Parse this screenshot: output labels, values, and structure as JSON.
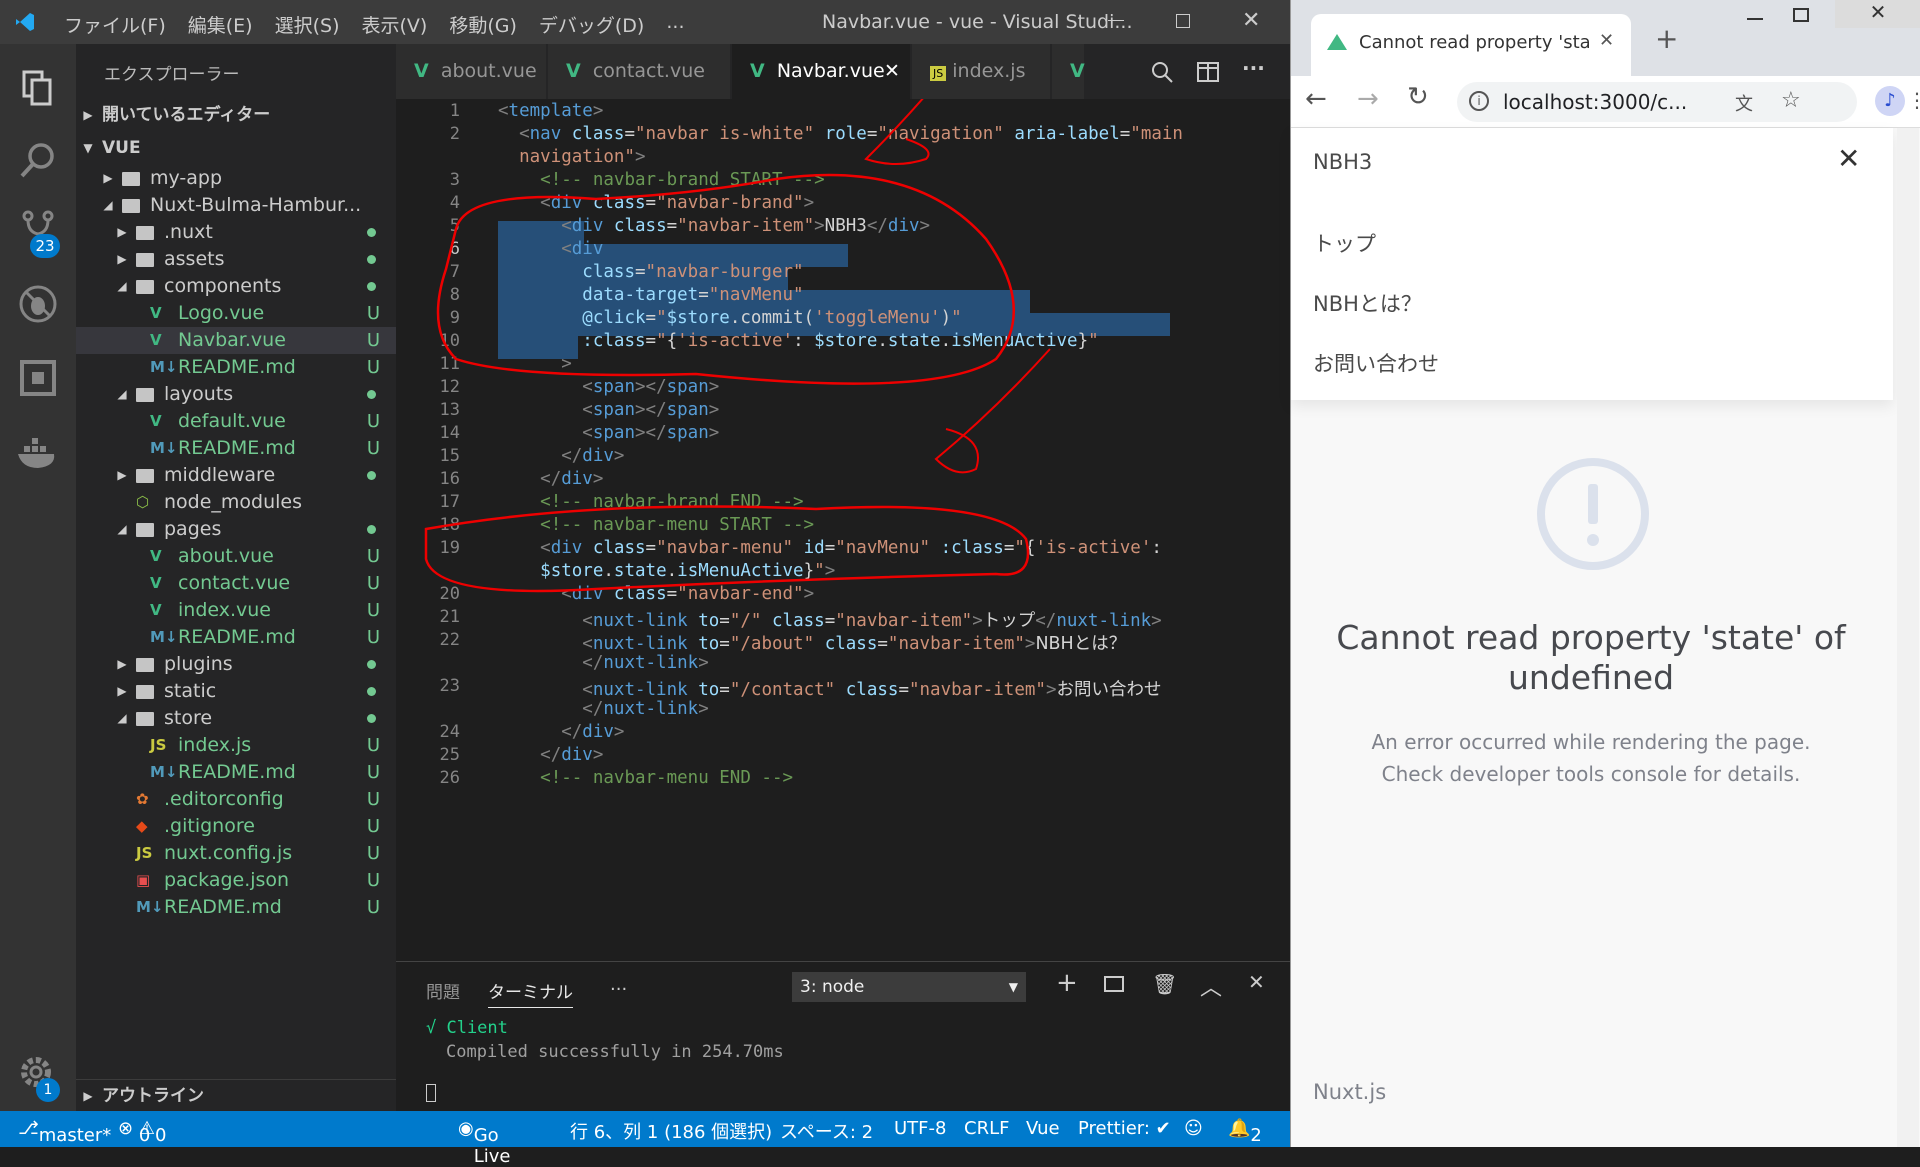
{
  "vscode": {
    "menu": [
      "ファイル(F)",
      "編集(E)",
      "選択(S)",
      "表示(V)",
      "移動(G)",
      "デバッグ(D)",
      "..."
    ],
    "window_title": "Navbar.vue - vue - Visual Studi...",
    "scm_badge": "23",
    "settings_badge": "1",
    "explorer_title": "エクスプローラー",
    "open_editors": "開いているエディター",
    "root": "VUE",
    "outline": "アウトライン",
    "tree": [
      {
        "label": "my-app",
        "status": ""
      },
      {
        "label": "Nuxt-Bulma-Hambur...",
        "status": ""
      },
      {
        "label": ".nuxt",
        "status": ""
      },
      {
        "label": "assets",
        "status": ""
      },
      {
        "label": "components",
        "status": ""
      },
      {
        "label": "Logo.vue",
        "status": "U"
      },
      {
        "label": "Navbar.vue",
        "status": "U"
      },
      {
        "label": "README.md",
        "status": "U"
      },
      {
        "label": "layouts",
        "status": ""
      },
      {
        "label": "default.vue",
        "status": "U"
      },
      {
        "label": "README.md",
        "status": "U"
      },
      {
        "label": "middleware",
        "status": ""
      },
      {
        "label": "node_modules",
        "status": ""
      },
      {
        "label": "pages",
        "status": ""
      },
      {
        "label": "about.vue",
        "status": "U"
      },
      {
        "label": "contact.vue",
        "status": "U"
      },
      {
        "label": "index.vue",
        "status": "U"
      },
      {
        "label": "README.md",
        "status": "U"
      },
      {
        "label": "plugins",
        "status": ""
      },
      {
        "label": "static",
        "status": ""
      },
      {
        "label": "store",
        "status": ""
      },
      {
        "label": "index.js",
        "status": "U"
      },
      {
        "label": "README.md",
        "status": "U"
      },
      {
        "label": ".editorconfig",
        "status": "U"
      },
      {
        "label": ".gitignore",
        "status": "U"
      },
      {
        "label": "nuxt.config.js",
        "status": "U"
      },
      {
        "label": "package.json",
        "status": "U"
      },
      {
        "label": "README.md",
        "status": "U"
      }
    ],
    "tabs": [
      "about.vue",
      "contact.vue",
      "Navbar.vue",
      "index.js"
    ],
    "line_numbers": [
      "1",
      "2",
      "",
      "3",
      "4",
      "5",
      "6",
      "7",
      "8",
      "9",
      "10",
      "11",
      "12",
      "13",
      "14",
      "15",
      "16",
      "17",
      "18",
      "19",
      "",
      "20",
      "21",
      "22",
      "",
      "23",
      "",
      "24",
      "25",
      "26"
    ],
    "panel": {
      "tab_problems": "問題",
      "tab_terminal": "ターミナル",
      "more": "...",
      "terminal_select": "3: node",
      "line1": "√ Client",
      "line2": "Compiled successfully in 254.70ms"
    },
    "status": {
      "branch": "master*",
      "errors": "0",
      "warnings": "0",
      "golive": "Go Live",
      "position": "行 6、列 1 (186 個選択)",
      "spaces": "スペース: 2",
      "encoding": "UTF-8",
      "eol": "CRLF",
      "lang": "Vue",
      "prettier": "Prettier: ✔",
      "notif": "2"
    }
  },
  "chrome": {
    "tab_title": "Cannot read property 'stat",
    "url": "localhost:3000/c...",
    "nav_brand": "NBH3",
    "menu_items": [
      "トップ",
      "NBHとは？",
      "お問い合わせ"
    ],
    "error_title": "Cannot read property 'state' of undefined",
    "error_line1": "An error occurred while rendering the page.",
    "error_line2": "Check developer tools console for details.",
    "footer": "Nuxt.js"
  }
}
